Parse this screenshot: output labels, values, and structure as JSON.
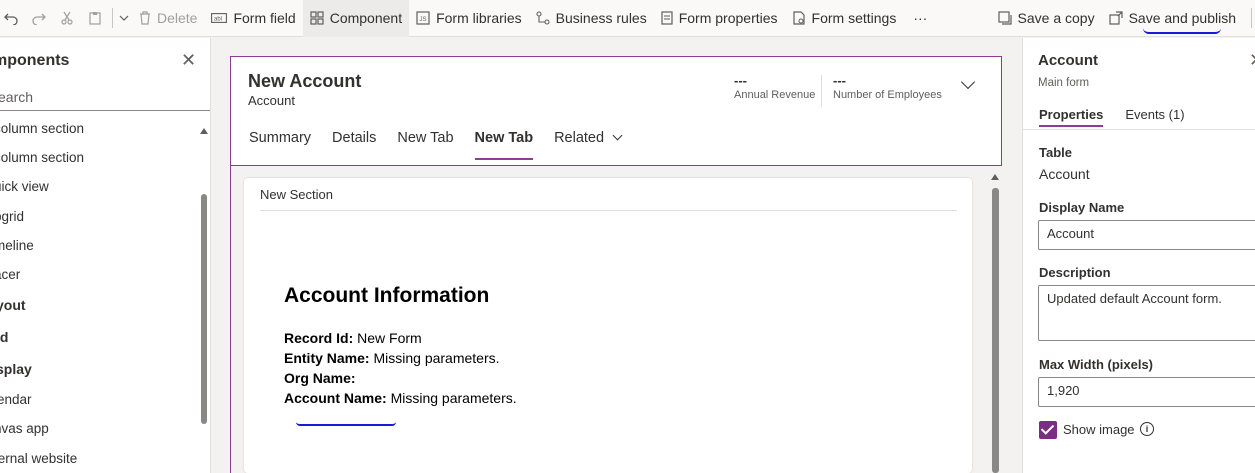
{
  "toolbar": {
    "undo_icon": "undo-icon",
    "redo_icon": "redo-icon",
    "cut_icon": "cut-icon",
    "paste_icon": "paste-icon",
    "delete_label": "Delete",
    "form_field_label": "Form field",
    "component_label": "Component",
    "form_libraries_label": "Form libraries",
    "business_rules_label": "Business rules",
    "form_properties_label": "Form properties",
    "form_settings_label": "Form settings",
    "more_label": "···",
    "save_copy_label": "Save a copy",
    "save_publish_label": "Save and publish"
  },
  "left_panel": {
    "title": "mponents",
    "search_placeholder": "earch",
    "items": [
      {
        "label": "column section",
        "category": false
      },
      {
        "label": "column section",
        "category": false
      },
      {
        "label": "uick view",
        "category": false
      },
      {
        "label": "bgrid",
        "category": false
      },
      {
        "label": "meline",
        "category": false
      },
      {
        "label": "acer",
        "category": false
      },
      {
        "label": "yout",
        "category": true
      },
      {
        "label": "id",
        "category": true
      },
      {
        "label": "splay",
        "category": true
      },
      {
        "label": "lendar",
        "category": false
      },
      {
        "label": "nvas app",
        "category": false
      },
      {
        "label": "ternal website",
        "category": false
      }
    ]
  },
  "form": {
    "title": "New Account",
    "entity": "Account",
    "header_fields": [
      {
        "value": "---",
        "label": "Annual Revenue"
      },
      {
        "value": "---",
        "label": "Number of Employees"
      }
    ],
    "tabs": [
      "Summary",
      "Details",
      "New Tab",
      "New Tab",
      "Related"
    ],
    "active_tab_index": 3,
    "section_title": "New Section",
    "info_title": "Account Information",
    "info_rows": [
      {
        "key": "Record Id:",
        "value": " New Form"
      },
      {
        "key": "Entity Name:",
        "value": " Missing parameters."
      },
      {
        "key": "Org Name:",
        "value": ""
      },
      {
        "key": "Account Name:",
        "value": " Missing parameters."
      }
    ]
  },
  "right_panel": {
    "title": "Account",
    "subtitle": "Main form",
    "tabs": [
      "Properties",
      "Events (1)"
    ],
    "table_label": "Table",
    "table_value": "Account",
    "display_name_label": "Display Name",
    "display_name_value": "Account",
    "description_label": "Description",
    "description_value": "Updated default Account form.",
    "max_width_label": "Max Width (pixels)",
    "max_width_value": "1,920",
    "show_image_label": "Show image",
    "show_image_checked": true
  },
  "colors": {
    "accent": "#8a3d93",
    "annotation": "#1a1ad6",
    "toolbar_bg": "#faf9f8",
    "canvas_bg": "#f3f2f1"
  }
}
